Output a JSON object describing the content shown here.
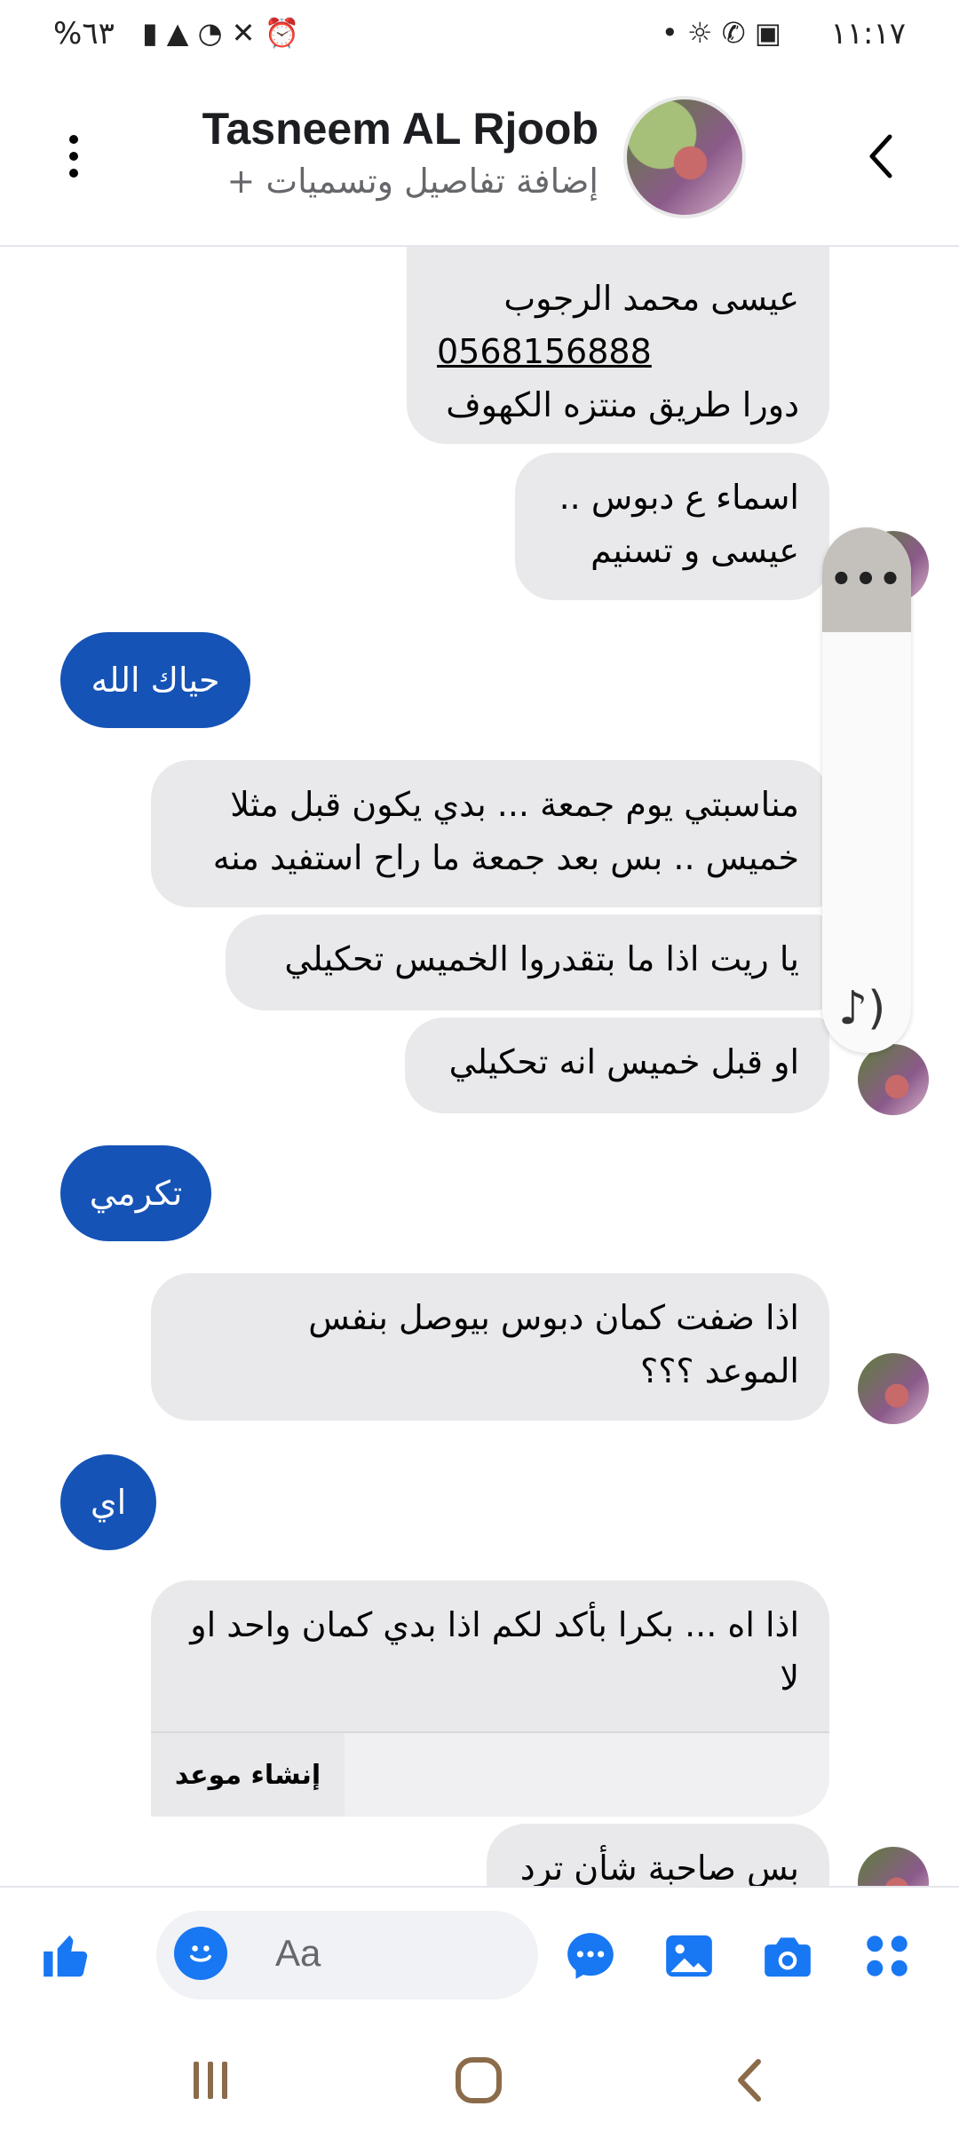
{
  "status_bar": {
    "time": "١١:١٧",
    "battery": "%٦٣",
    "left_icons": "▮ ▲ ◔ ✕ ⏰",
    "right_icons": "• ☼ ✆ ▣"
  },
  "header": {
    "title": "Tasneem AL Rjoob",
    "subtitle": "+ إضافة تفاصيل وتسميات"
  },
  "messages": {
    "m1": [
      "عيسى محمد الرجوب",
      "0568156888",
      "دورا طريق منتزه الكهوف"
    ],
    "m2": [
      "اسماء ع دبوس ..",
      "عيسى و تسنيم"
    ],
    "m3": "حياك الله",
    "m4": [
      "مناسبتي يوم جمعة  ... بدي يكون قبل مثلا",
      "خميس .. بس بعد جمعة ما راح استفيد منه"
    ],
    "m5": "يا ريت اذا ما بتقدروا  الخميس تحكيلي",
    "m6": "او قبل خميس انه تحكيلي",
    "m7": "تكرمي",
    "m8": [
      "اذا ضفت كمان دبوس بيوصل بنفس",
      "الموعد ؟؟؟"
    ],
    "m9": "اي",
    "m10": [
      "اذا اه ... بكرا بأكد لكم اذا بدي كمان واحد او",
      "لا"
    ],
    "m10_action": "إنشاء موعد",
    "m11": "بس صاحبة شأن ترد"
  },
  "overlay": {
    "more": "•••",
    "sound": "♪)"
  },
  "composer": {
    "placeholder": "Aa"
  },
  "colors": {
    "accent": "#1877f2",
    "outgoing_bubble": "#1553b6",
    "incoming_bubble": "#e9e9eb"
  }
}
